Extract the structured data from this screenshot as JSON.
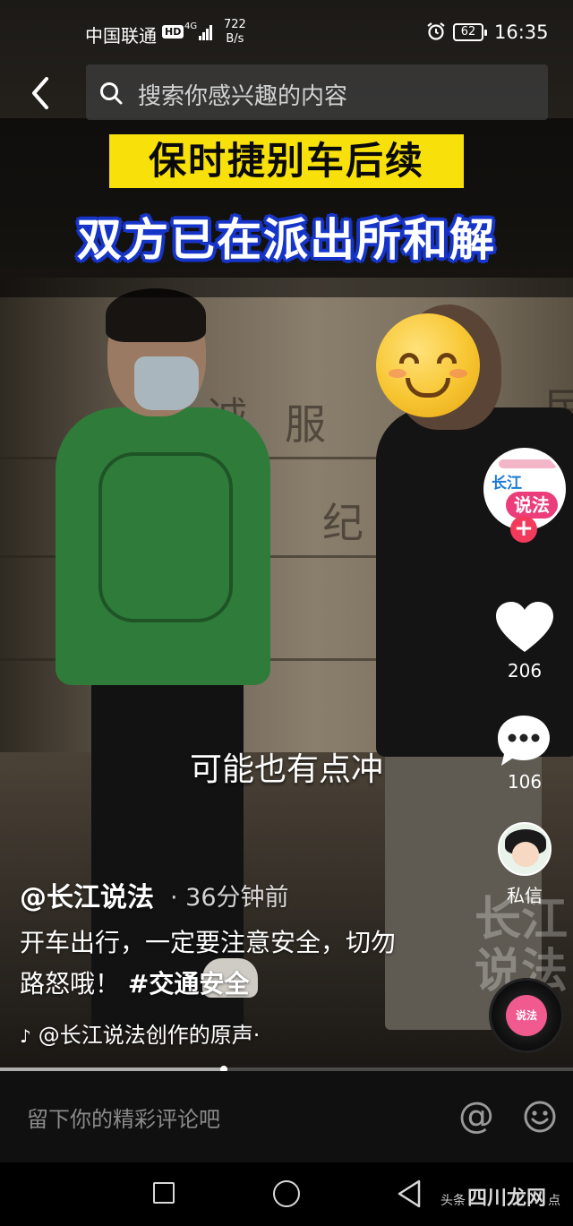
{
  "status_bar": {
    "carrier": "中国联通",
    "hd": "HD",
    "network": "4G",
    "speed_value": "722",
    "speed_unit": "B/s",
    "battery": "62",
    "time": "16:35"
  },
  "search": {
    "placeholder": "搜索你感兴趣的内容"
  },
  "video": {
    "title_line1": "保时捷别车后续",
    "title_line2": "双方已在派出所和解",
    "subtitle": "可能也有点冲",
    "watermark": "长江说法",
    "engravings": [
      "诚",
      "服",
      "纪",
      "民"
    ]
  },
  "author_avatar": {
    "line1": "长江",
    "line2": "说法",
    "follow": "+"
  },
  "actions": {
    "like_count": "206",
    "comment_count": "106",
    "dm_label": "私信"
  },
  "post": {
    "author": "@长江说法",
    "time": "· 36分钟前",
    "description": "开车出行，一定要注意安全，切勿路怒哦！",
    "hashtag": "#交通安全",
    "music": "@长江说法创作的原声·"
  },
  "progress": {
    "played_fraction": 0.39
  },
  "comment_bar": {
    "placeholder": "留下你的精彩评论吧",
    "at_symbol": "@"
  },
  "nav": {
    "brand_left": "头条",
    "brand_mid": "四川龙网",
    "brand_right": "点"
  },
  "colors": {
    "title_yellow": "#f8e10a",
    "title_blue_outline": "#1635c8",
    "follow_red": "#f23a5c"
  }
}
